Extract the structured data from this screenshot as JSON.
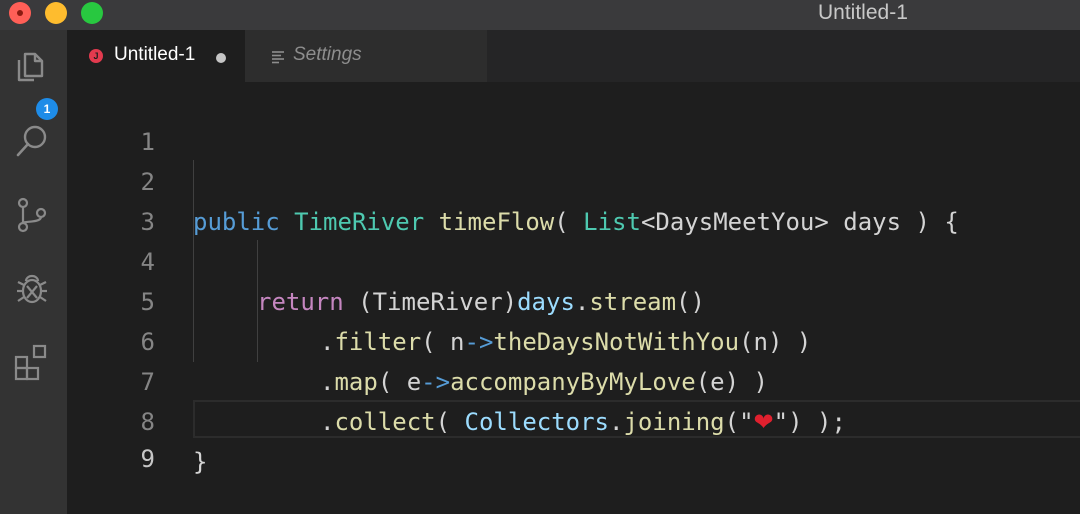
{
  "window": {
    "title": "Untitled-1"
  },
  "activity_bar": {
    "items": [
      {
        "icon": "files-icon",
        "badge": "1"
      },
      {
        "icon": "search-icon"
      },
      {
        "icon": "source-control-icon"
      },
      {
        "icon": "debug-icon"
      },
      {
        "icon": "extensions-icon"
      }
    ]
  },
  "tabs": [
    {
      "label": "Untitled-1",
      "active": true,
      "dirty": true,
      "icon": "java-file-icon"
    },
    {
      "label": "Settings",
      "active": false,
      "icon": "settings-lines-icon"
    }
  ],
  "editor": {
    "line_numbers": [
      "1",
      "2",
      "3",
      "4",
      "5",
      "6",
      "7",
      "8",
      "9"
    ],
    "current_line": "9",
    "tokens": {
      "l2_public": "public",
      "l2_sp1": " ",
      "l2_type": "TimeRiver",
      "l2_sp2": " ",
      "l2_fn": "timeFlow",
      "l2_paren": "( ",
      "l2_list": "List",
      "l2_generic": "<DaysMeetYou> days ) {",
      "l4_return": "return",
      "l4_cast": " (TimeRiver)",
      "l4_days": "days",
      "l4_dot": ".",
      "l4_stream": "stream",
      "l4_end": "()",
      "l5_dot": ".",
      "l5_filter": "filter",
      "l5_open": "( n",
      "l5_arrow": "->",
      "l5_fn": "theDaysNotWithYou",
      "l5_end": "(n) )",
      "l6_dot": ".",
      "l6_map": "map",
      "l6_open": "( e",
      "l6_arrow": "->",
      "l6_fn": "accompanyByMyLove",
      "l6_end": "(e) )",
      "l7_dot": ".",
      "l7_collect": "collect",
      "l7_open": "( ",
      "l7_collectors": "Collectors",
      "l7_dot2": ".",
      "l7_joining": "joining",
      "l7_paren": "(",
      "l7_q1": "\"",
      "l7_heart": "❤",
      "l7_q2": "\"",
      "l7_end": ") );",
      "l8_brace": "}"
    }
  },
  "colors": {
    "keyword": "#569cd6",
    "control_keyword": "#c586c0",
    "type": "#4ec9b0",
    "function": "#dcdcaa",
    "variable": "#9cdcfe",
    "background": "#1e1e1e"
  }
}
